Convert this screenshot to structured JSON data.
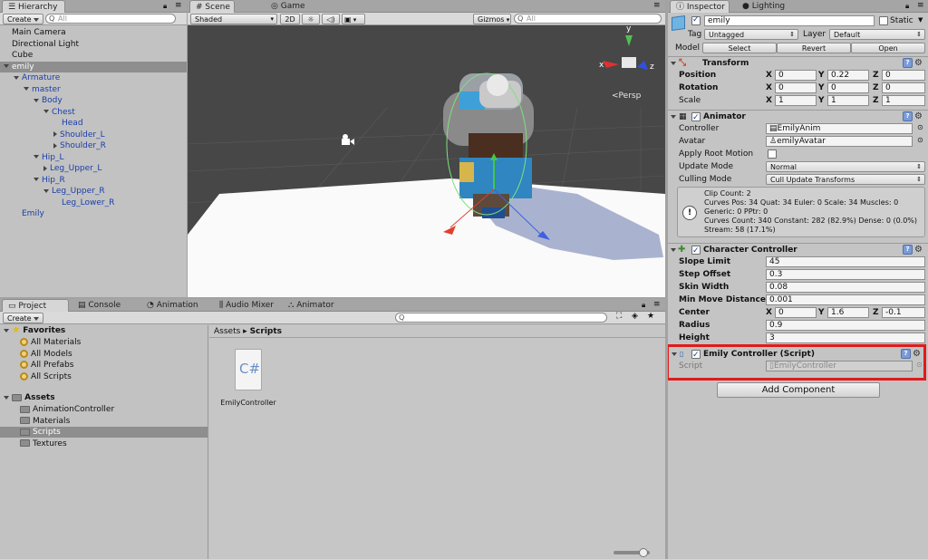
{
  "hierarchy": {
    "tab": "Hierarchy",
    "create": "Create",
    "search_placeholder": "All",
    "items": [
      {
        "label": "Main Camera",
        "indent": 0,
        "arrow": "",
        "blue": false,
        "selected": false
      },
      {
        "label": "Directional Light",
        "indent": 0,
        "arrow": "",
        "blue": false,
        "selected": false
      },
      {
        "label": "Cube",
        "indent": 0,
        "arrow": "",
        "blue": false,
        "selected": false
      },
      {
        "label": "emily",
        "indent": 0,
        "arrow": "down",
        "blue": false,
        "selected": true
      },
      {
        "label": "Armature",
        "indent": 1,
        "arrow": "down",
        "blue": true,
        "selected": false
      },
      {
        "label": "master",
        "indent": 2,
        "arrow": "down",
        "blue": true,
        "selected": false
      },
      {
        "label": "Body",
        "indent": 3,
        "arrow": "down",
        "blue": true,
        "selected": false
      },
      {
        "label": "Chest",
        "indent": 4,
        "arrow": "down",
        "blue": true,
        "selected": false
      },
      {
        "label": "Head",
        "indent": 5,
        "arrow": "",
        "blue": true,
        "selected": false
      },
      {
        "label": "Shoulder_L",
        "indent": 5,
        "arrow": "right",
        "blue": true,
        "selected": false
      },
      {
        "label": "Shoulder_R",
        "indent": 5,
        "arrow": "right",
        "blue": true,
        "selected": false
      },
      {
        "label": "Hip_L",
        "indent": 3,
        "arrow": "down",
        "blue": true,
        "selected": false
      },
      {
        "label": "Leg_Upper_L",
        "indent": 4,
        "arrow": "right",
        "blue": true,
        "selected": false
      },
      {
        "label": "Hip_R",
        "indent": 3,
        "arrow": "down",
        "blue": true,
        "selected": false
      },
      {
        "label": "Leg_Upper_R",
        "indent": 4,
        "arrow": "down",
        "blue": true,
        "selected": false
      },
      {
        "label": "Leg_Lower_R",
        "indent": 5,
        "arrow": "",
        "blue": true,
        "selected": false
      },
      {
        "label": "Emily",
        "indent": 1,
        "arrow": "",
        "blue": true,
        "selected": false
      }
    ]
  },
  "scene": {
    "tab_scene": "Scene",
    "tab_game": "Game",
    "shading": "Shaded",
    "mode_2d": "2D",
    "gizmos": "Gizmos",
    "search_placeholder": "All",
    "persp": "Persp",
    "axis_x": "x",
    "axis_y": "y",
    "axis_z": "z"
  },
  "bottom_tabs": {
    "project": "Project",
    "console": "Console",
    "animation": "Animation",
    "audio_mixer": "Audio Mixer",
    "animator": "Animator"
  },
  "project": {
    "create": "Create",
    "favorites": "Favorites",
    "favorite_items": [
      "All Materials",
      "All Models",
      "All Prefabs",
      "All Scripts"
    ],
    "assets": "Assets",
    "asset_folders": [
      "AnimationController",
      "Materials",
      "Scripts",
      "Textures"
    ],
    "selected_folder": "Scripts",
    "breadcrumb_root": "Assets",
    "breadcrumb_current": "Scripts",
    "file_name": "EmilyController",
    "file_icon_text": "C#"
  },
  "inspector": {
    "tab": "Inspector",
    "tab_lighting": "Lighting",
    "object_name": "emily",
    "static_label": "Static",
    "tag_label": "Tag",
    "tag_value": "Untagged",
    "layer_label": "Layer",
    "layer_value": "Default",
    "model_label": "Model",
    "model_select": "Select",
    "model_revert": "Revert",
    "model_open": "Open",
    "transform": {
      "title": "Transform",
      "position_label": "Position",
      "rotation_label": "Rotation",
      "scale_label": "Scale",
      "position": [
        "0",
        "0.22",
        "0"
      ],
      "rotation": [
        "0",
        "0",
        "0"
      ],
      "scale": [
        "1",
        "1",
        "1"
      ]
    },
    "animator": {
      "title": "Animator",
      "controller_label": "Controller",
      "controller_value": "EmilyAnim",
      "avatar_label": "Avatar",
      "avatar_value": "emilyAvatar",
      "root_motion_label": "Apply Root Motion",
      "update_mode_label": "Update Mode",
      "update_mode_value": "Normal",
      "culling_mode_label": "Culling Mode",
      "culling_mode_value": "Cull Update Transforms",
      "info_lines": [
        "Clip Count: 2",
        "Curves Pos: 34 Quat: 34 Euler: 0 Scale: 34 Muscles: 0",
        "Generic: 0 PPtr: 0",
        "Curves Count: 340 Constant: 282 (82.9%) Dense: 0 (0.0%)",
        "Stream: 58 (17.1%)"
      ]
    },
    "character_controller": {
      "title": "Character Controller",
      "slope_limit_label": "Slope Limit",
      "slope_limit": "45",
      "step_offset_label": "Step Offset",
      "step_offset": "0.3",
      "skin_width_label": "Skin Width",
      "skin_width": "0.08",
      "min_move_label": "Min Move Distance",
      "min_move": "0.001",
      "center_label": "Center",
      "center": [
        "0",
        "1.6",
        "-0.1"
      ],
      "radius_label": "Radius",
      "radius": "0.9",
      "height_label": "Height",
      "height": "3"
    },
    "script_component": {
      "title": "Emily Controller (Script)",
      "script_label": "Script",
      "script_value": "EmilyController",
      "highlight_color": "#e01b1b"
    },
    "add_component": "Add Component",
    "axes": [
      "X",
      "Y",
      "Z"
    ]
  }
}
